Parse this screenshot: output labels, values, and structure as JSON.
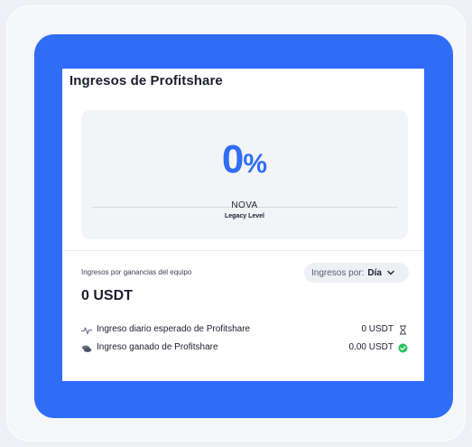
{
  "card": {
    "title": "Ingresos de Profitshare"
  },
  "hero": {
    "percent_value": "0",
    "percent_sign": "%",
    "level_name": "NOVA",
    "level_label": "Legacy Level"
  },
  "team": {
    "label": "Ingresos por ganancias del equipo",
    "period_label": "Ingresos por:",
    "period_value": "Día",
    "total": "0 USDT"
  },
  "rows": [
    {
      "label": "Ingreso diario esperado de Profitshare",
      "value": "0 USDT",
      "icon": "activity-icon",
      "trail_icon": "hourglass-icon"
    },
    {
      "label": "Ingreso ganado de Profitshare",
      "value": "0.00 USDT",
      "icon": "coins-icon",
      "trail_icon": "check-circle-icon"
    }
  ],
  "colors": {
    "accent": "#2f6df6",
    "success": "#22c55e"
  }
}
